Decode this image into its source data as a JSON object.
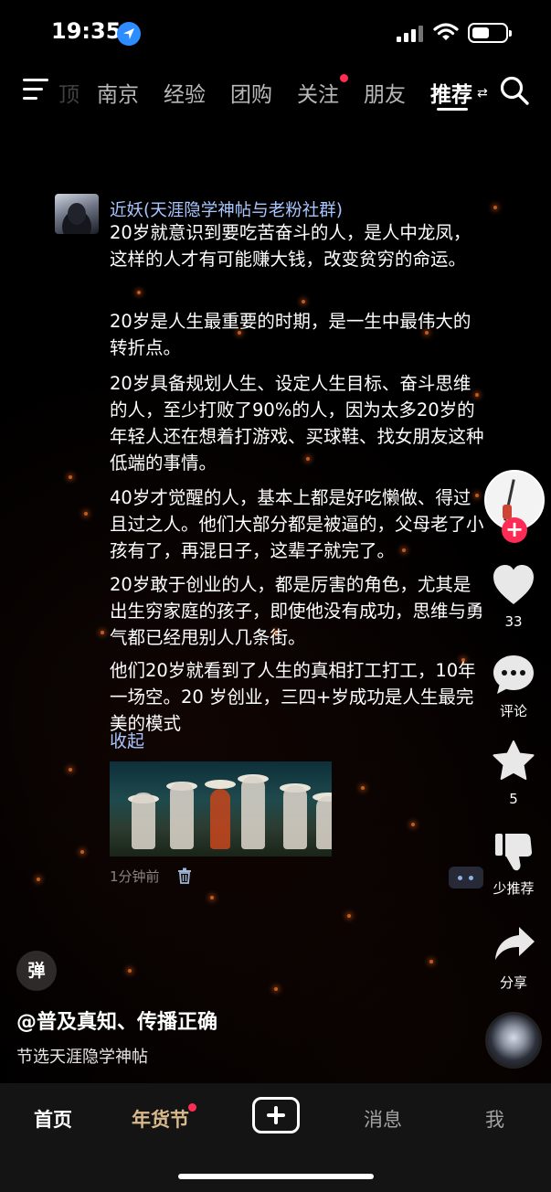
{
  "status_bar": {
    "time": "19:35"
  },
  "top_nav": {
    "tabs": [
      {
        "label": "顶"
      },
      {
        "label": "南京"
      },
      {
        "label": "经验"
      },
      {
        "label": "团购"
      },
      {
        "label": "关注",
        "has_dot": true
      },
      {
        "label": "朋友"
      },
      {
        "label": "推荐",
        "active": true
      }
    ]
  },
  "post": {
    "author": "近妖(天涯隐学神帖与老粉社群)",
    "paragraphs": [
      "20岁就意识到要吃苦奋斗的人，是人中龙凤，这样的人才有可能赚大钱，改变贫穷的命运。",
      "20岁是人生最重要的时期，是一生中最伟大的转折点。",
      "20岁具备规划人生、设定人生目标、奋斗思维的人，至少打败了90%的人，因为太多20岁的年轻人还在想着打游戏、买球鞋、找女朋友这种低端的事情。",
      "40岁才觉醒的人，基本上都是好吃懒做、得过且过之人。他们大部分都是被逼的，父母老了小孩有了，再混日子，这辈子就完了。",
      "20岁敢于创业的人，都是厉害的角色，尤其是出生穷家庭的孩子，即使他没有成功，思维与勇气都已经甩别人几条街。",
      "他们20岁就看到了人生的真相打工打工，10年一场空。20 岁创业，三四+岁成功是人生最完美的模式"
    ],
    "collapse_label": "收起",
    "timestamp": "1分钟前"
  },
  "rail": {
    "likes": "33",
    "comment_label": "评论",
    "favorites": "5",
    "dislike_label": "少推荐",
    "share_label": "分享",
    "follow_symbol": "+"
  },
  "video": {
    "danmaku_label": "弹",
    "username": "@普及真知、传播正确",
    "caption": "节选天涯隐学神帖"
  },
  "bottom_bar": {
    "home": "首页",
    "festival": "年货节",
    "messages": "消息",
    "me": "我"
  },
  "colors": {
    "accent_red": "#fe2c55",
    "link_blue": "#a9c6ff",
    "festival_gold": "#d8b98a"
  }
}
